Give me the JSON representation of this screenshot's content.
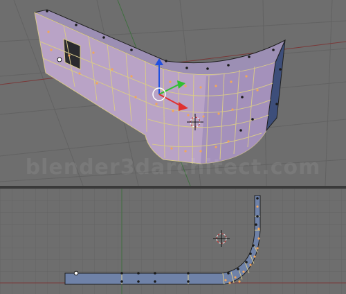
{
  "watermark": {
    "text": "blender3darchitect.com"
  },
  "colors": {
    "viewport_bg": "#6e6e6e",
    "grid": "#666666",
    "wall_face": "#b9a3c6",
    "wall_face_dark": "#8e80a6",
    "edge": "#d8c98a",
    "selected_vertex": "#f2a65a",
    "vertex": "#1a1a1a",
    "axis_x": "#e03030",
    "axis_y": "#30c030",
    "axis_z": "#2050e0",
    "end_face": "#3d4e7a"
  },
  "viewports": [
    {
      "name": "3D perspective view",
      "icon": "3d-cursor-icon"
    },
    {
      "name": "Top orthographic view",
      "icon": "3d-cursor-icon"
    }
  ]
}
